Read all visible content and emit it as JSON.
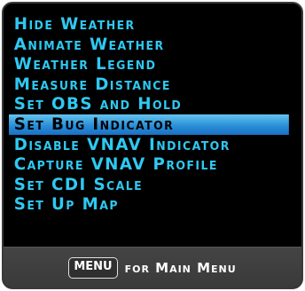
{
  "menu": {
    "items": [
      {
        "label": "Hide Weather"
      },
      {
        "label": "Animate Weather"
      },
      {
        "label": "Weather Legend"
      },
      {
        "label": "Measure Distance"
      },
      {
        "label": "Set OBS and Hold"
      },
      {
        "label": "Set Bug Indicator"
      },
      {
        "label": "Disable VNAV Indicator"
      },
      {
        "label": "Capture VNAV Profile"
      },
      {
        "label": "Set CDI Scale"
      },
      {
        "label": "Set Up Map"
      }
    ],
    "selected_index": 5
  },
  "footer": {
    "key_label": "MENU",
    "hint_text": "for Main Menu"
  },
  "colors": {
    "item_text": "#2ec9f2",
    "highlight": "#2a8fd8",
    "background": "#000000",
    "footer_bg": "#3f3f3f"
  }
}
